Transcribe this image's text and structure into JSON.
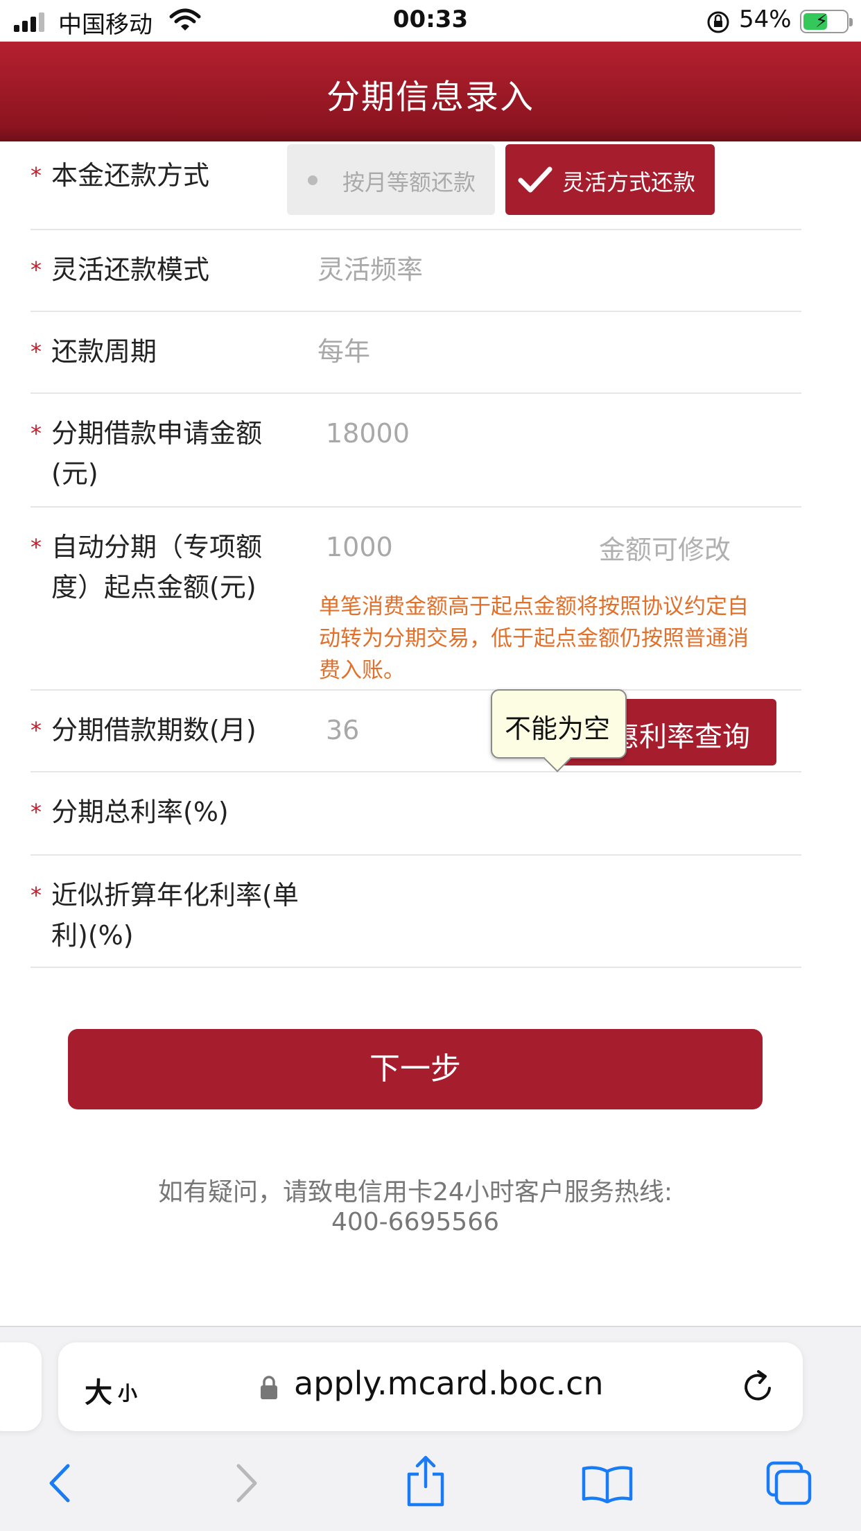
{
  "status_bar": {
    "carrier": "中国移动",
    "time": "00:33",
    "battery_percent": "54%"
  },
  "header": {
    "title": "分期信息录入"
  },
  "form": {
    "required_mark": "*",
    "repayment_method": {
      "label": "本金还款方式",
      "option_monthly": "按月等额还款",
      "option_flexible": "灵活方式还款",
      "selected": "灵活方式还款"
    },
    "flexible_mode": {
      "label": "灵活还款模式",
      "value": "灵活频率"
    },
    "repayment_cycle": {
      "label": "还款周期",
      "value": "每年"
    },
    "loan_amount": {
      "label": "分期借款申请金额(元)",
      "value": "18000"
    },
    "auto_installment": {
      "label": "自动分期（专项额度）起点金额(元)",
      "value": "1000",
      "hint": "金额可修改",
      "notice": "单笔消费金额高于起点金额将按照协议约定自动转为分期交易，低于起点金额仍按照普通消费入账。"
    },
    "loan_term": {
      "label": "分期借款期数(月)",
      "value": "36",
      "query_button": "优惠利率查询",
      "tooltip": "不能为空"
    },
    "total_rate": {
      "label": "分期总利率(%)",
      "value": ""
    },
    "annual_rate": {
      "label": "近似折算年化利率(单利)(%)",
      "value": ""
    }
  },
  "next_button": "下一步",
  "footer": {
    "line1": "如有疑问，请致电信用卡24小时客户服务热线:",
    "line2": "400-6695566"
  },
  "browser": {
    "text_size_big": "大",
    "text_size_small": "小",
    "url": "apply.mcard.boc.cn"
  },
  "colors": {
    "brand_red": "#a61e2e",
    "notice_orange": "#e0702a",
    "ios_blue": "#1a7cf5"
  }
}
